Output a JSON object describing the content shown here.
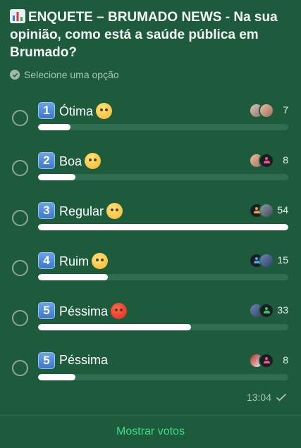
{
  "poll": {
    "question": "ENQUETE – BRUMADO NEWS - Na sua opinião, como está a saúde pública em Brumado?",
    "question_icon": "bar-chart-emoji",
    "hint": "Selecione uma opção",
    "options": [
      {
        "number": "1",
        "label": "Ótima",
        "emoji": "joy-emoji",
        "votes": "7",
        "fraction": 0.13
      },
      {
        "number": "2",
        "label": "Boa",
        "emoji": "grin-emoji",
        "votes": "8",
        "fraction": 0.15
      },
      {
        "number": "3",
        "label": "Regular",
        "emoji": "relieved-emoji",
        "votes": "54",
        "fraction": 1.0
      },
      {
        "number": "4",
        "label": "Ruim",
        "emoji": "persevere-emoji",
        "votes": "15",
        "fraction": 0.28
      },
      {
        "number": "5",
        "label": "Péssima",
        "emoji": "angry-emoji",
        "votes": "33",
        "fraction": 0.61
      },
      {
        "number": "5",
        "label": "Péssima",
        "emoji": "",
        "votes": "8",
        "fraction": 0.15
      }
    ],
    "time": "13:04",
    "show_votes_label": "Mostrar votos"
  },
  "colors": {
    "background": "#1e5b3d",
    "bar_track": "#2f6e50",
    "bar_fill": "#ffffff",
    "accent": "#3ddc84",
    "keycap": "#4a86d6"
  }
}
